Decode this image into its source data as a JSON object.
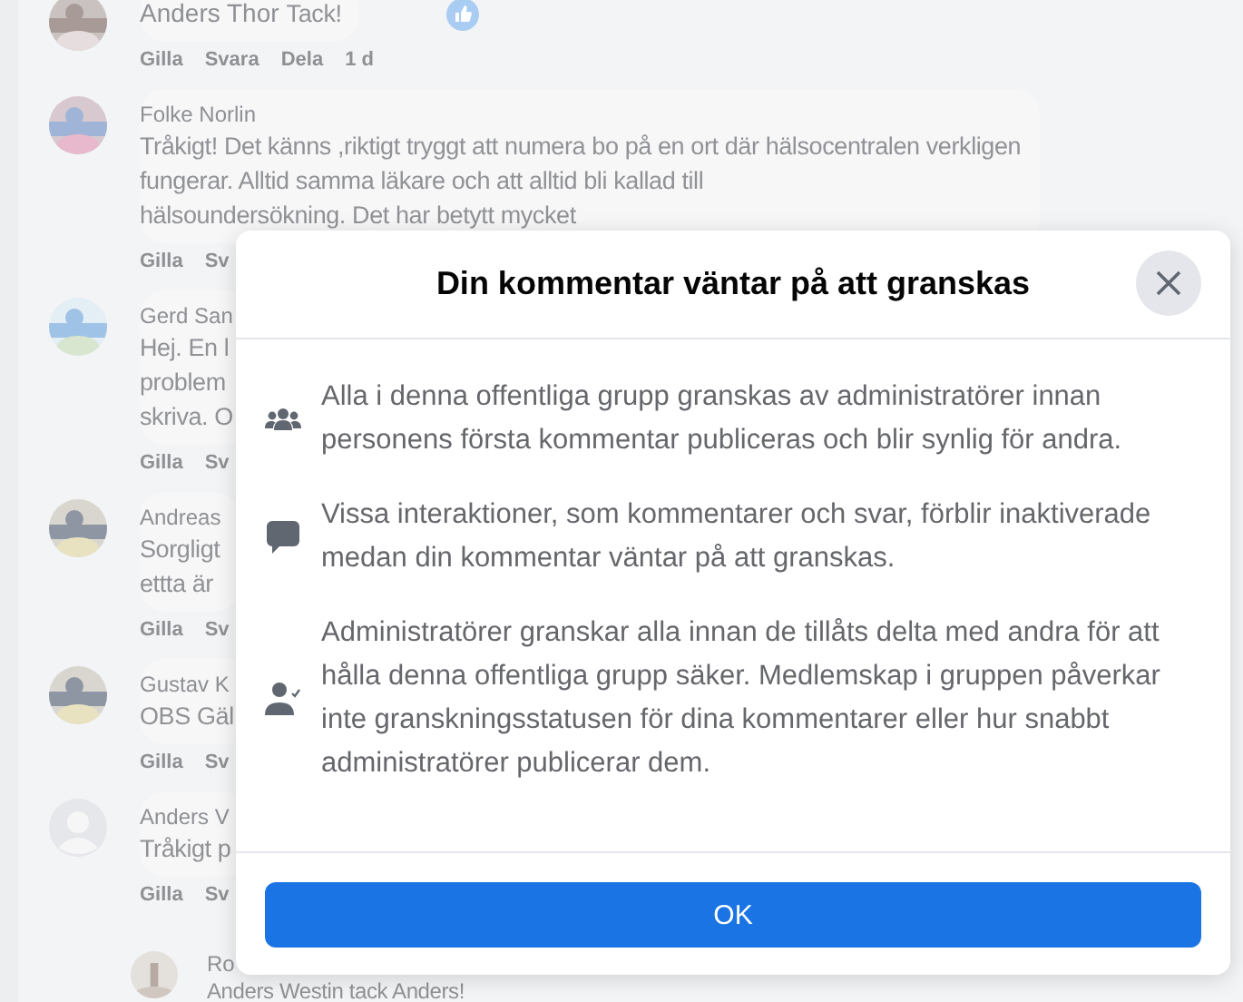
{
  "comments": [
    {
      "author": "Anders Thor",
      "inline_text": "Tack!",
      "actions": [
        "Gilla",
        "Svara",
        "Dela",
        "1 d"
      ]
    },
    {
      "author": "Folke Norlin",
      "lines": [
        "Tråkigt! Det känns ,riktigt tryggt att numera bo på en ort där hälsocentralen verkligen",
        "fungerar. Alltid samma läkare och att alltid bli kallad till",
        "hälsoundersökning. Det har betytt mycket"
      ],
      "actions": [
        "Gilla",
        "Sv"
      ]
    },
    {
      "author": "Gerd San",
      "lines": [
        "Hej. En l",
        "problem",
        "skriva. O"
      ],
      "actions": [
        "Gilla",
        "Sv"
      ]
    },
    {
      "author": "Andreas",
      "lines": [
        "Sorgligt",
        "ettta är"
      ],
      "actions": [
        "Gilla",
        "Sv"
      ]
    },
    {
      "author": "Gustav K",
      "lines": [
        "OBS Gäl"
      ],
      "actions": [
        "Gilla",
        "Sv"
      ]
    },
    {
      "author": "Anders V",
      "lines": [
        "Tråkigt p"
      ],
      "actions": [
        "Gilla",
        "Sv"
      ]
    }
  ],
  "reply": {
    "author": "Ro",
    "text": "Anders Westin tack Anders!"
  },
  "dialog": {
    "title": "Din kommentar väntar på att granskas",
    "items": [
      {
        "text": "Alla i denna offentliga grupp granskas av administratörer innan personens första kommentar publiceras och blir synlig för andra."
      },
      {
        "text": "Vissa interaktioner, som kommentarer och svar, förblir inaktiverade medan din kommentar väntar på att granskas."
      },
      {
        "text": "Administratörer granskar alla innan de tillåts delta med andra för att hålla denna offentliga grupp säker. Medlemskap i gruppen påverkar inte granskningsstatusen för dina kommentarer eller hur snabbt administratörer publicerar dem."
      }
    ],
    "button": "OK"
  }
}
